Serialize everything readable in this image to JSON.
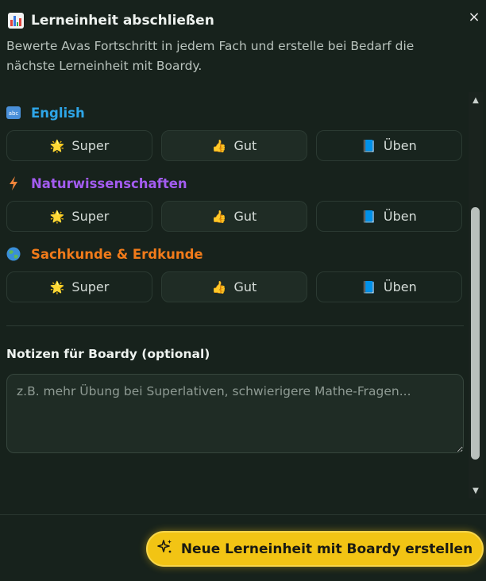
{
  "dialog": {
    "title": "Lerneinheit abschließen",
    "close_label": "×",
    "subtitle": "Bewerte Avas Fortschritt in jedem Fach und erstelle bei Bedarf die nächste Lerneinheit mit Boardy."
  },
  "subjects": [
    {
      "name": "English",
      "icon": "abc-icon",
      "color": "#2ea6e8",
      "ratings": [
        {
          "label": "Super",
          "emoji": "🌟"
        },
        {
          "label": "Gut",
          "emoji": "👍"
        },
        {
          "label": "Üben",
          "emoji": "📘"
        }
      ]
    },
    {
      "name": "Naturwissenschaften",
      "icon": "lightning-icon",
      "color": "#a35cf0",
      "ratings": [
        {
          "label": "Super",
          "emoji": "🌟"
        },
        {
          "label": "Gut",
          "emoji": "👍"
        },
        {
          "label": "Üben",
          "emoji": "📘"
        }
      ]
    },
    {
      "name": "Sachkunde & Erdkunde",
      "icon": "globe-icon",
      "color": "#f17b1a",
      "ratings": [
        {
          "label": "Super",
          "emoji": "🌟"
        },
        {
          "label": "Gut",
          "emoji": "👍"
        },
        {
          "label": "Üben",
          "emoji": "📘"
        }
      ]
    }
  ],
  "notes": {
    "label": "Notizen für Boardy (optional)",
    "placeholder": "z.B. mehr Übung bei Superlativen, schwierigere Mathe-Fragen...",
    "value": ""
  },
  "footer": {
    "create_label": "Neue Lerneinheit mit Boardy erstellen",
    "create_icon": "sparkle-icon",
    "accent": "#f2c414"
  }
}
